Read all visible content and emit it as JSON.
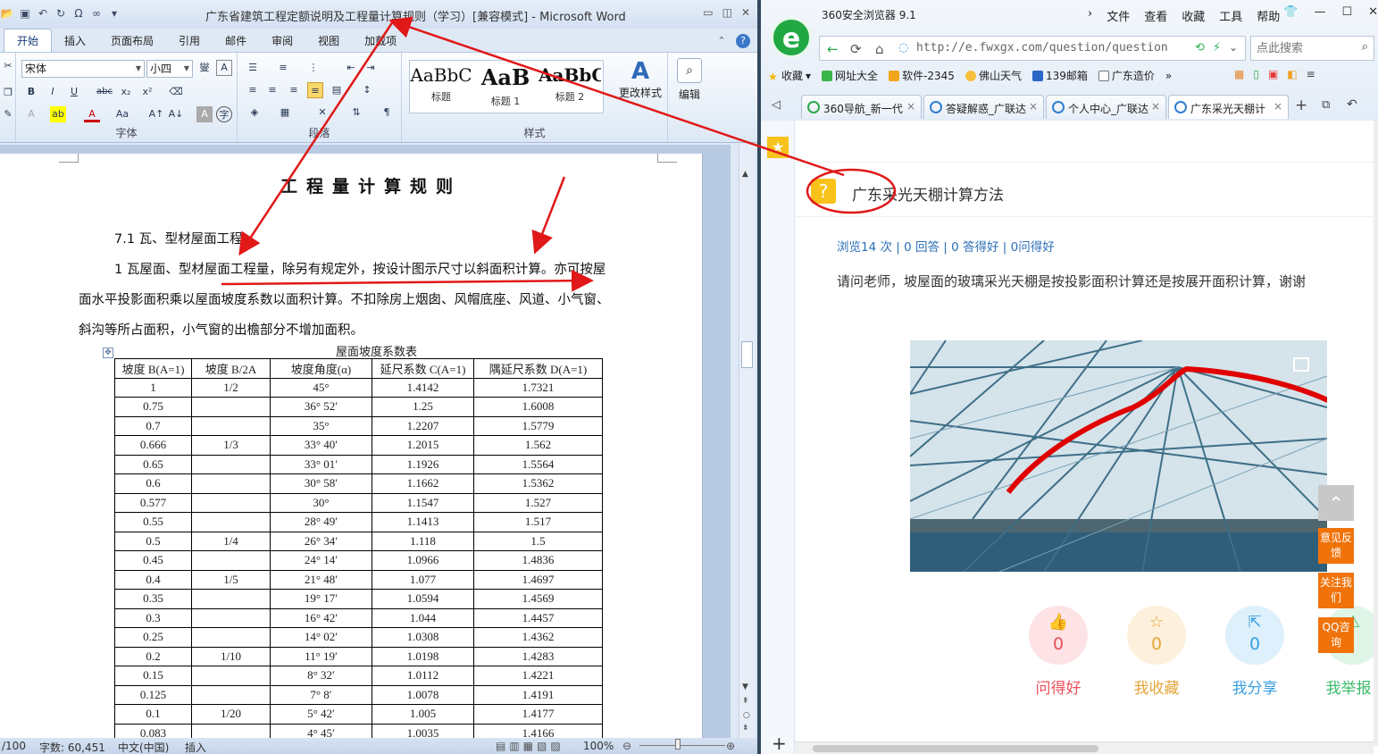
{
  "word": {
    "window_title": "广东省建筑工程定额说明及工程量计算规则（学习）[兼容模式] - Microsoft Word",
    "tabs": [
      "开始",
      "插入",
      "页面布局",
      "引用",
      "邮件",
      "审阅",
      "视图",
      "加载项"
    ],
    "font_name": "宋体",
    "font_size": "小四",
    "groups": {
      "font": "字体",
      "paragraph": "段落",
      "styles": "样式"
    },
    "styles": [
      {
        "preview": "AaBbC",
        "name": "标题"
      },
      {
        "preview": "AaB",
        "name": "标题 1"
      },
      {
        "preview": "AaBbC",
        "name": "标题 2"
      }
    ],
    "change_styles": "更改样式",
    "edit": "编辑",
    "doc": {
      "heading": "工程量计算规则",
      "section": "7.1  瓦、型材屋面工程",
      "para_line1": "1 瓦屋面、型材屋面工程量，除另有规定外，按设计图示尺寸以斜面积计算。亦可按屋",
      "para_line2": "面水平投影面积乘以屋面坡度系数以面积计算。不扣除房上烟囱、风帽底座、风道、小气窗、",
      "para_line3": "斜沟等所占面积，小气窗的出檐部分不增加面积。",
      "table_caption": "屋面坡度系数表",
      "table_headers": [
        "坡度 B(A=1)",
        "坡度  B/2A",
        "坡度角度(α)",
        "延尺系数 C(A=1)",
        "隅延尺系数 D(A=1)"
      ],
      "table_rows": [
        [
          "1",
          "1/2",
          "45°",
          "1.4142",
          "1.7321"
        ],
        [
          "0.75",
          "",
          "36° 52′",
          "1.25",
          "1.6008"
        ],
        [
          "0.7",
          "",
          "35°",
          "1.2207",
          "1.5779"
        ],
        [
          "0.666",
          "1/3",
          "33° 40′",
          "1.2015",
          "1.562"
        ],
        [
          "0.65",
          "",
          "33° 01′",
          "1.1926",
          "1.5564"
        ],
        [
          "0.6",
          "",
          "30° 58′",
          "1.1662",
          "1.5362"
        ],
        [
          "0.577",
          "",
          "30°",
          "1.1547",
          "1.527"
        ],
        [
          "0.55",
          "",
          "28° 49′",
          "1.1413",
          "1.517"
        ],
        [
          "0.5",
          "1/4",
          "26° 34′",
          "1.118",
          "1.5"
        ],
        [
          "0.45",
          "",
          "24° 14′",
          "1.0966",
          "1.4836"
        ],
        [
          "0.4",
          "1/5",
          "21° 48′",
          "1.077",
          "1.4697"
        ],
        [
          "0.35",
          "",
          "19° 17′",
          "1.0594",
          "1.4569"
        ],
        [
          "0.3",
          "",
          "16° 42′",
          "1.044",
          "1.4457"
        ],
        [
          "0.25",
          "",
          "14° 02′",
          "1.0308",
          "1.4362"
        ],
        [
          "0.2",
          "1/10",
          "11° 19′",
          "1.0198",
          "1.4283"
        ],
        [
          "0.15",
          "",
          "8° 32′",
          "1.0112",
          "1.4221"
        ],
        [
          "0.125",
          "",
          "7° 8′",
          "1.0078",
          "1.4191"
        ],
        [
          "0.1",
          "1/20",
          "5° 42′",
          "1.005",
          "1.4177"
        ],
        [
          "0.083",
          "",
          "4° 45′",
          "1.0035",
          "1.4166"
        ]
      ]
    },
    "status": {
      "page": "/100",
      "words": "字数: 60,451",
      "lang": "中文(中国)",
      "mode": "插入",
      "zoom": "100%"
    }
  },
  "browser": {
    "name": "360安全浏览器 9.1",
    "menu": [
      "文件",
      "查看",
      "收藏",
      "工具",
      "帮助"
    ],
    "url": "http://e.fwxgx.com/question/question",
    "search_placeholder": "点此搜索",
    "favorites": [
      "收藏",
      "网址大全",
      "软件-2345",
      "佛山天气",
      "139邮箱",
      "广东造价"
    ],
    "tabs": [
      "360导航_新一代",
      "答疑解惑_广联达",
      "个人中心_广联达",
      "广东采光天棚计"
    ],
    "question": {
      "title": "广东采光天棚计算方法",
      "stats": "浏览14 次 | 0 回答 | 0 答得好 | 0问得好",
      "text": "请问老师，坡屋面的玻璃采光天棚是按投影面积计算还是按展开面积计算，谢谢"
    },
    "actions": [
      {
        "label": "问得好",
        "count": "0",
        "color": "#e8505b",
        "bg": "#fde3e5"
      },
      {
        "label": "我收藏",
        "count": "0",
        "color": "#e4a63b",
        "bg": "#fdf0dc"
      },
      {
        "label": "我分享",
        "count": "0",
        "color": "#3ba0e0",
        "bg": "#def0fb"
      },
      {
        "label": "我举报",
        "count": "",
        "color": "#3dbb6a",
        "bg": "#dff5e7"
      }
    ],
    "float_buttons": [
      "意见反馈",
      "关注我们",
      "QQ咨询"
    ]
  }
}
